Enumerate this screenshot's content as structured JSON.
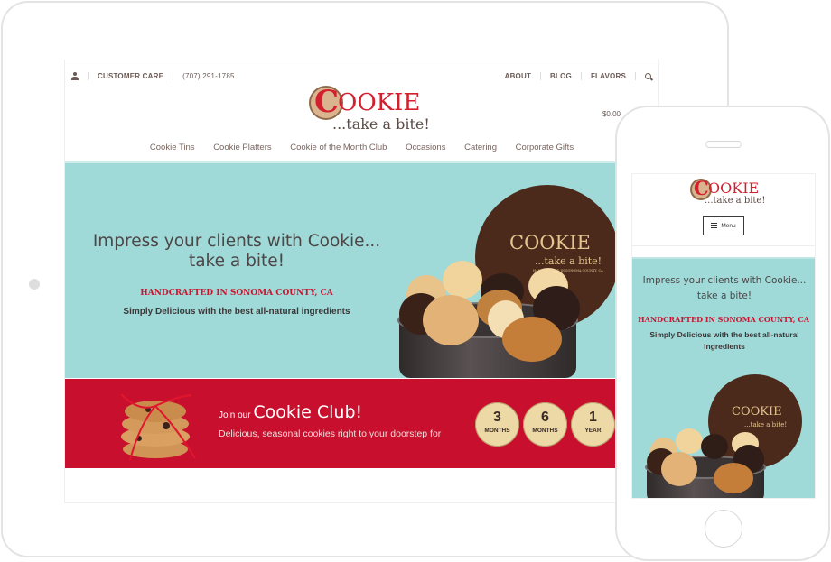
{
  "tablet": {
    "topbar": {
      "user_icon": "user-icon",
      "customer_care": "CUSTOMER CARE",
      "phone": "(707) 291-1785",
      "right_links": [
        "ABOUT",
        "BLOG",
        "FLAVORS"
      ],
      "search_icon": "search-icon"
    },
    "logo": {
      "letter": "C",
      "word": "OOKIE",
      "tagline": "...take a bite!"
    },
    "cart": "$0.00",
    "nav": [
      "Cookie Tins",
      "Cookie Platters",
      "Cookie of the Month Club",
      "Occasions",
      "Catering",
      "Corporate Gifts"
    ],
    "hero": {
      "headline": "Impress your clients with Cookie... take a bite!",
      "subhead": "HANDCRAFTED IN SONOMA COUNTY, CA",
      "text": "Simply Delicious with the best all-natural ingredients",
      "tin_logo_word": "COOKIE",
      "tin_logo_tagline": "...take a bite!",
      "tin_small_text": "HANDCRAFTED IN SONOMA COUNTY, CA"
    },
    "club": {
      "join_prefix": "Join our",
      "join_title": "Cookie Club!",
      "description": "Delicious, seasonal cookies right to your doorstep for",
      "options": [
        {
          "num": "3",
          "unit": "MONTHS"
        },
        {
          "num": "6",
          "unit": "MONTHS"
        },
        {
          "num": "1",
          "unit": "YEAR"
        }
      ]
    }
  },
  "phone": {
    "logo": {
      "letter": "C",
      "word": "OOKIE",
      "tagline": "...take a bite!"
    },
    "menu_label": "Menu",
    "hero": {
      "headline": "Impress your clients with Cookie... take a bite!",
      "subhead": "HANDCRAFTED IN SONOMA COUNTY, CA",
      "text": "Simply Delicious with the best all-natural ingredients",
      "tin_logo_word": "COOKIE",
      "tin_logo_tagline": "...take a bite!"
    }
  },
  "colors": {
    "brand_red": "#c8102e",
    "hero_teal": "#9fd9d8",
    "text_brown": "#6b5a55",
    "badge_tan": "#ecd9a6"
  }
}
